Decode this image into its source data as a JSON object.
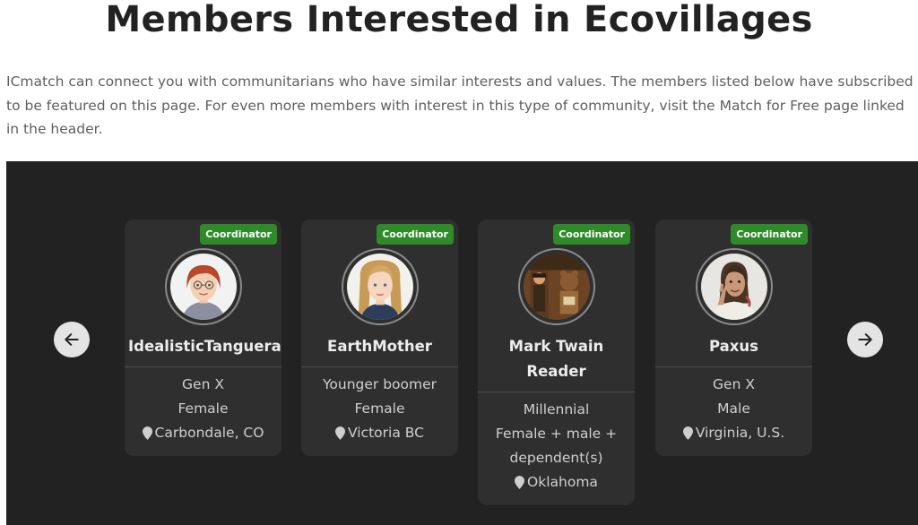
{
  "page": {
    "title": "Members Interested in Ecovillages",
    "intro": "ICmatch can connect you with communitarians who have similar interests and values. The members listed below have subscribed to be featured on this page. For even more members with interest in this type of community, visit the Match for Free page linked in the header."
  },
  "carousel": {
    "prev_icon": "arrow-left-icon",
    "next_icon": "arrow-right-icon",
    "members": [
      {
        "badge": "Coordinator",
        "name": "IdealisticTanguera",
        "generation": "Gen X",
        "household": "Female",
        "location": "Carbondale, CO"
      },
      {
        "badge": "Coordinator",
        "name": "EarthMother",
        "generation": "Younger boomer",
        "household": "Female",
        "location": "Victoria BC"
      },
      {
        "badge": "Coordinator",
        "name": "Mark Twain Reader",
        "generation": "Millennial",
        "household": "Female + male + dependent(s)",
        "location": "Oklahoma"
      },
      {
        "badge": "Coordinator",
        "name": "Paxus",
        "generation": "Gen X",
        "household": "Male",
        "location": "Virginia, U.S."
      }
    ]
  },
  "colors": {
    "carousel_bg": "#222222",
    "card_bg": "#2f2f2f",
    "badge_bg": "#2f8a2a",
    "arrow_bg": "#e4e4e4"
  }
}
